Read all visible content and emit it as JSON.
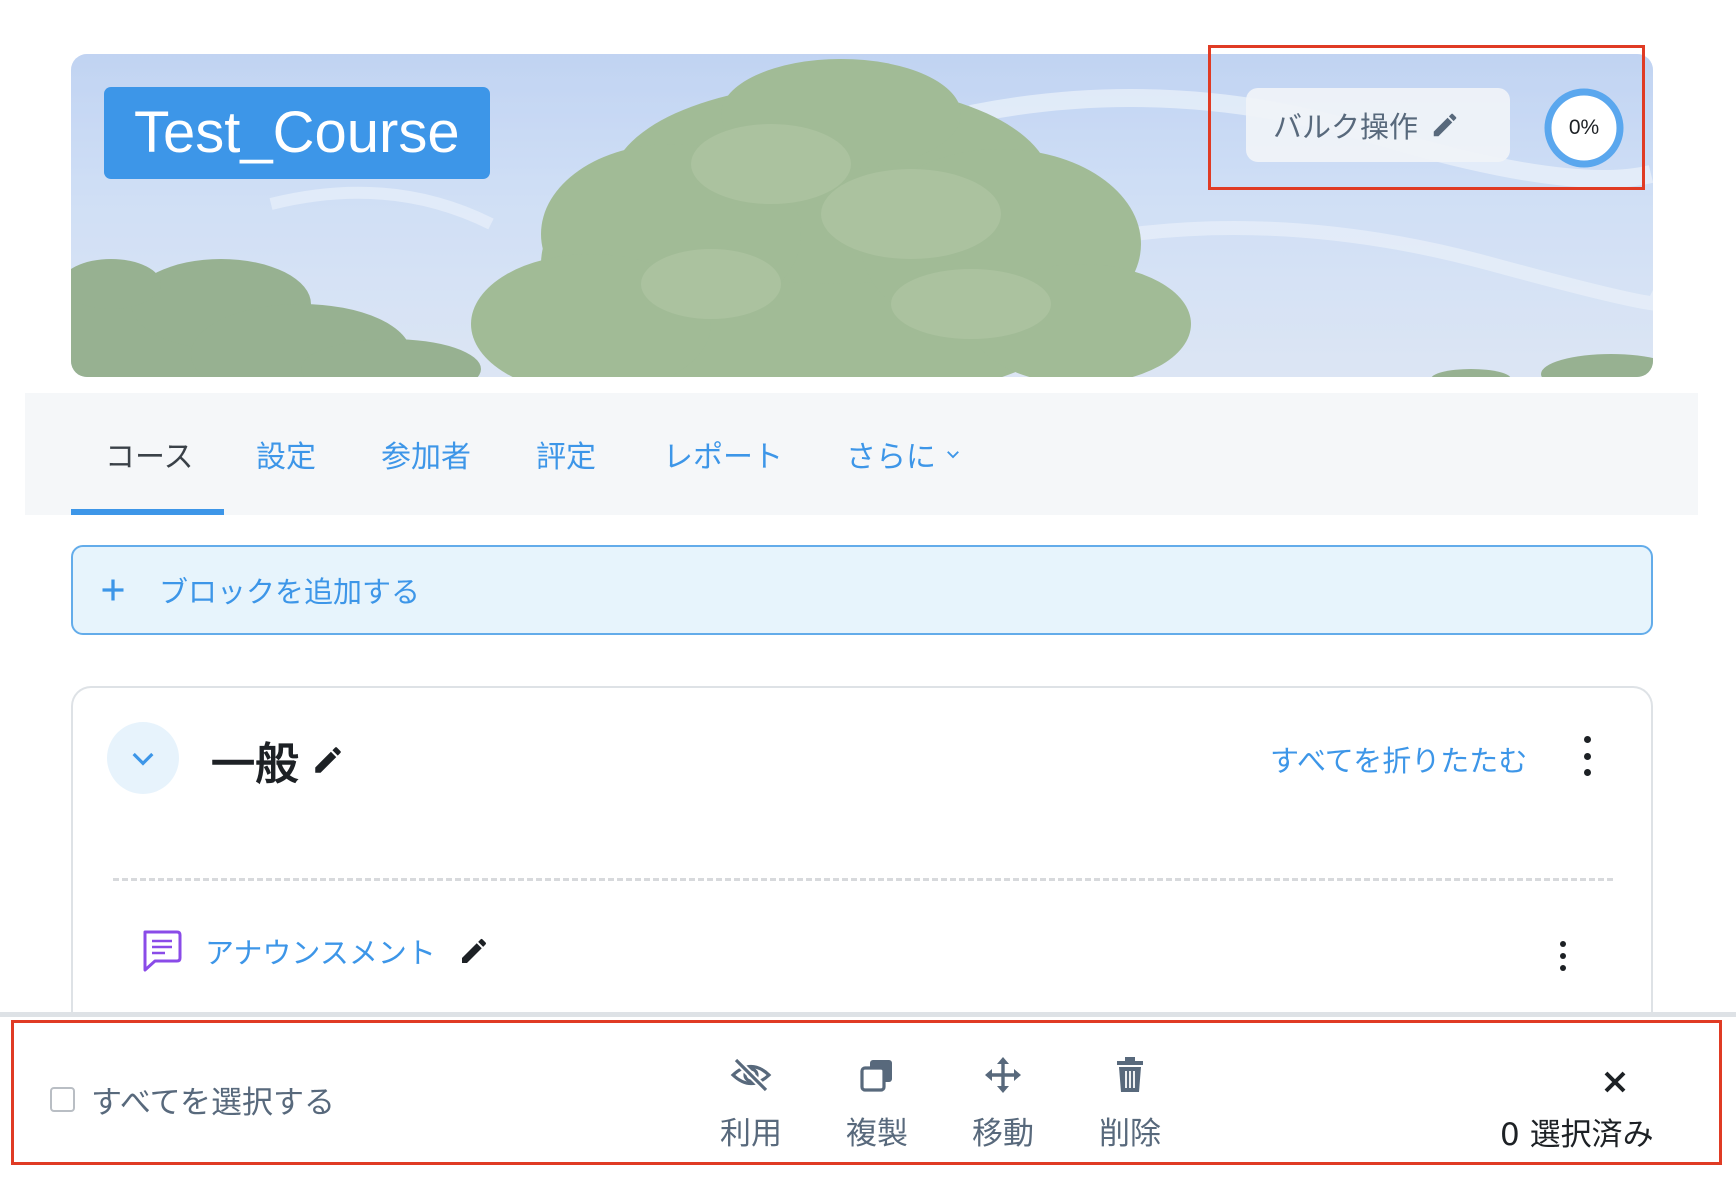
{
  "header": {
    "course_title": "Test_Course",
    "bulk_edit_label": "バルク操作",
    "bulk_edit_icon": "pencil-icon",
    "progress_text": "0%",
    "progress_value": 0,
    "accent_color": "#3d96e8",
    "highlight_color": "#e03b24"
  },
  "tabs": [
    {
      "label": "コース",
      "active": true
    },
    {
      "label": "設定",
      "active": false
    },
    {
      "label": "参加者",
      "active": false
    },
    {
      "label": "評定",
      "active": false
    },
    {
      "label": "レポート",
      "active": false
    },
    {
      "label": "さらに",
      "active": false,
      "icon": "chevron-down-icon"
    }
  ],
  "add_block": {
    "label": "ブロックを追加する",
    "icon": "plus-icon"
  },
  "section": {
    "title": "一般",
    "collapse_all": "すべてを折りたたむ",
    "activities": [
      {
        "name": "アナウンスメント",
        "icon": "forum-icon"
      }
    ]
  },
  "bulk_bar": {
    "select_all_label": "すべてを選択する",
    "select_all_checked": false,
    "actions": [
      {
        "label": "利用",
        "icon": "eye-slash-icon"
      },
      {
        "label": "複製",
        "icon": "copy-icon"
      },
      {
        "label": "移動",
        "icon": "move-icon"
      },
      {
        "label": "削除",
        "icon": "trash-icon"
      }
    ],
    "selected_count": "0 選択済み",
    "close_icon": "close-icon"
  }
}
